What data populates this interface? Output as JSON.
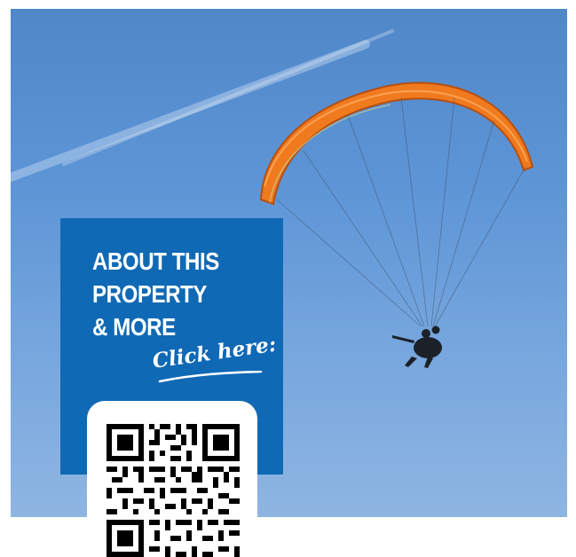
{
  "promo": {
    "heading_lines": [
      "ABOUT THIS",
      "PROPERTY",
      "& MORE"
    ],
    "cta_label": "Click here:",
    "brand_color": "#1069b5"
  },
  "photo": {
    "sky_color": "#5d95d6",
    "canopy_color": "#f07a1e"
  },
  "icons": {
    "qr": "qr-code-icon",
    "paraglider": "paraglider-icon"
  }
}
